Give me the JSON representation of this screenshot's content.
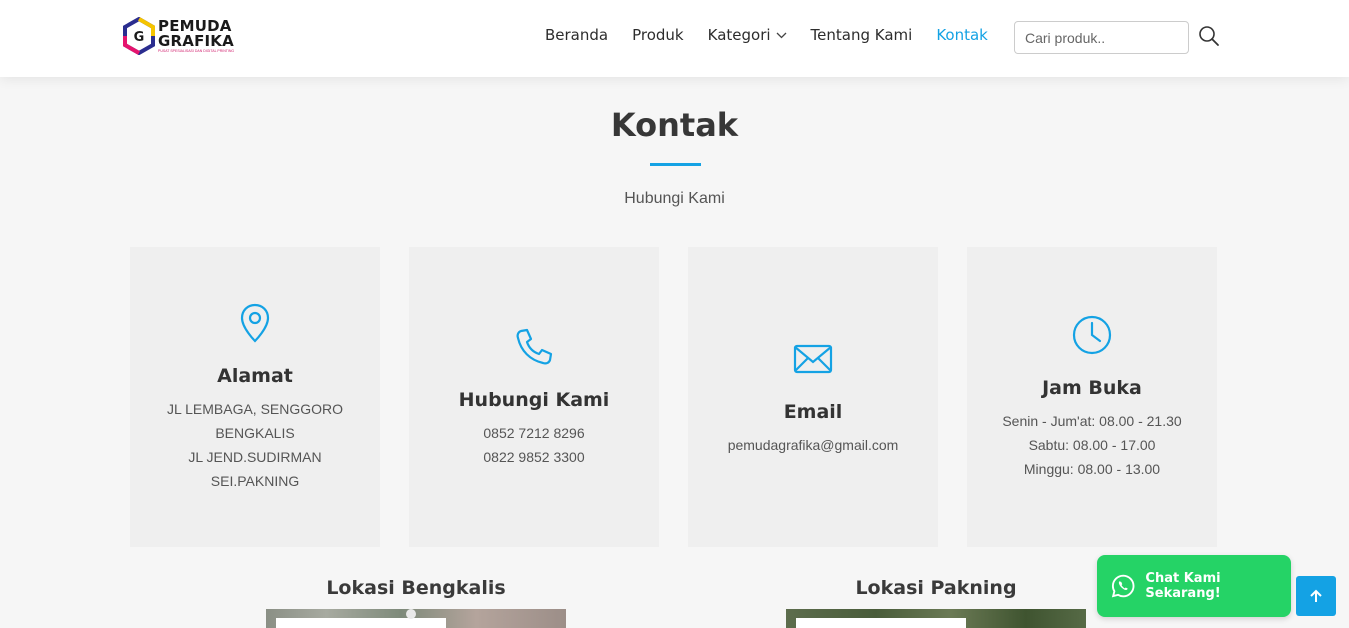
{
  "brand": {
    "line1": "PEMUDA",
    "line2": "GRAFIKA",
    "tagline": "PUSAT SPESIALISASI DAN DIGITAL PRINTING"
  },
  "nav": {
    "items": [
      {
        "label": "Beranda"
      },
      {
        "label": "Produk"
      },
      {
        "label": "Kategori"
      },
      {
        "label": "Tentang Kami"
      },
      {
        "label": "Kontak"
      }
    ],
    "active": "Kontak",
    "search_placeholder": "Cari produk.."
  },
  "page": {
    "title": "Kontak",
    "subtitle": "Hubungi Kami"
  },
  "cards": {
    "address": {
      "title": "Alamat",
      "lines": [
        "JL LEMBAGA, SENGGORO",
        "BENGKALIS",
        "JL JEND.SUDIRMAN",
        "SEI.PAKNING"
      ]
    },
    "phone": {
      "title": "Hubungi Kami",
      "lines": [
        "0852 7212 8296",
        "0822 9852 3300"
      ]
    },
    "email": {
      "title": "Email",
      "lines": [
        "pemudagrafika@gmail.com"
      ]
    },
    "hours": {
      "title": "Jam Buka",
      "lines": [
        "Senin - Jum'at: 08.00 - 21.30",
        "Sabtu: 08.00 - 17.00",
        "Minggu: 08.00 - 13.00"
      ]
    }
  },
  "locations": [
    {
      "title": "Lokasi Bengkalis"
    },
    {
      "title": "Lokasi Pakning"
    }
  ],
  "whatsapp": {
    "label": "Chat Kami Sekarang!"
  },
  "colors": {
    "accent": "#14a2e4",
    "whatsapp": "#25d366"
  }
}
